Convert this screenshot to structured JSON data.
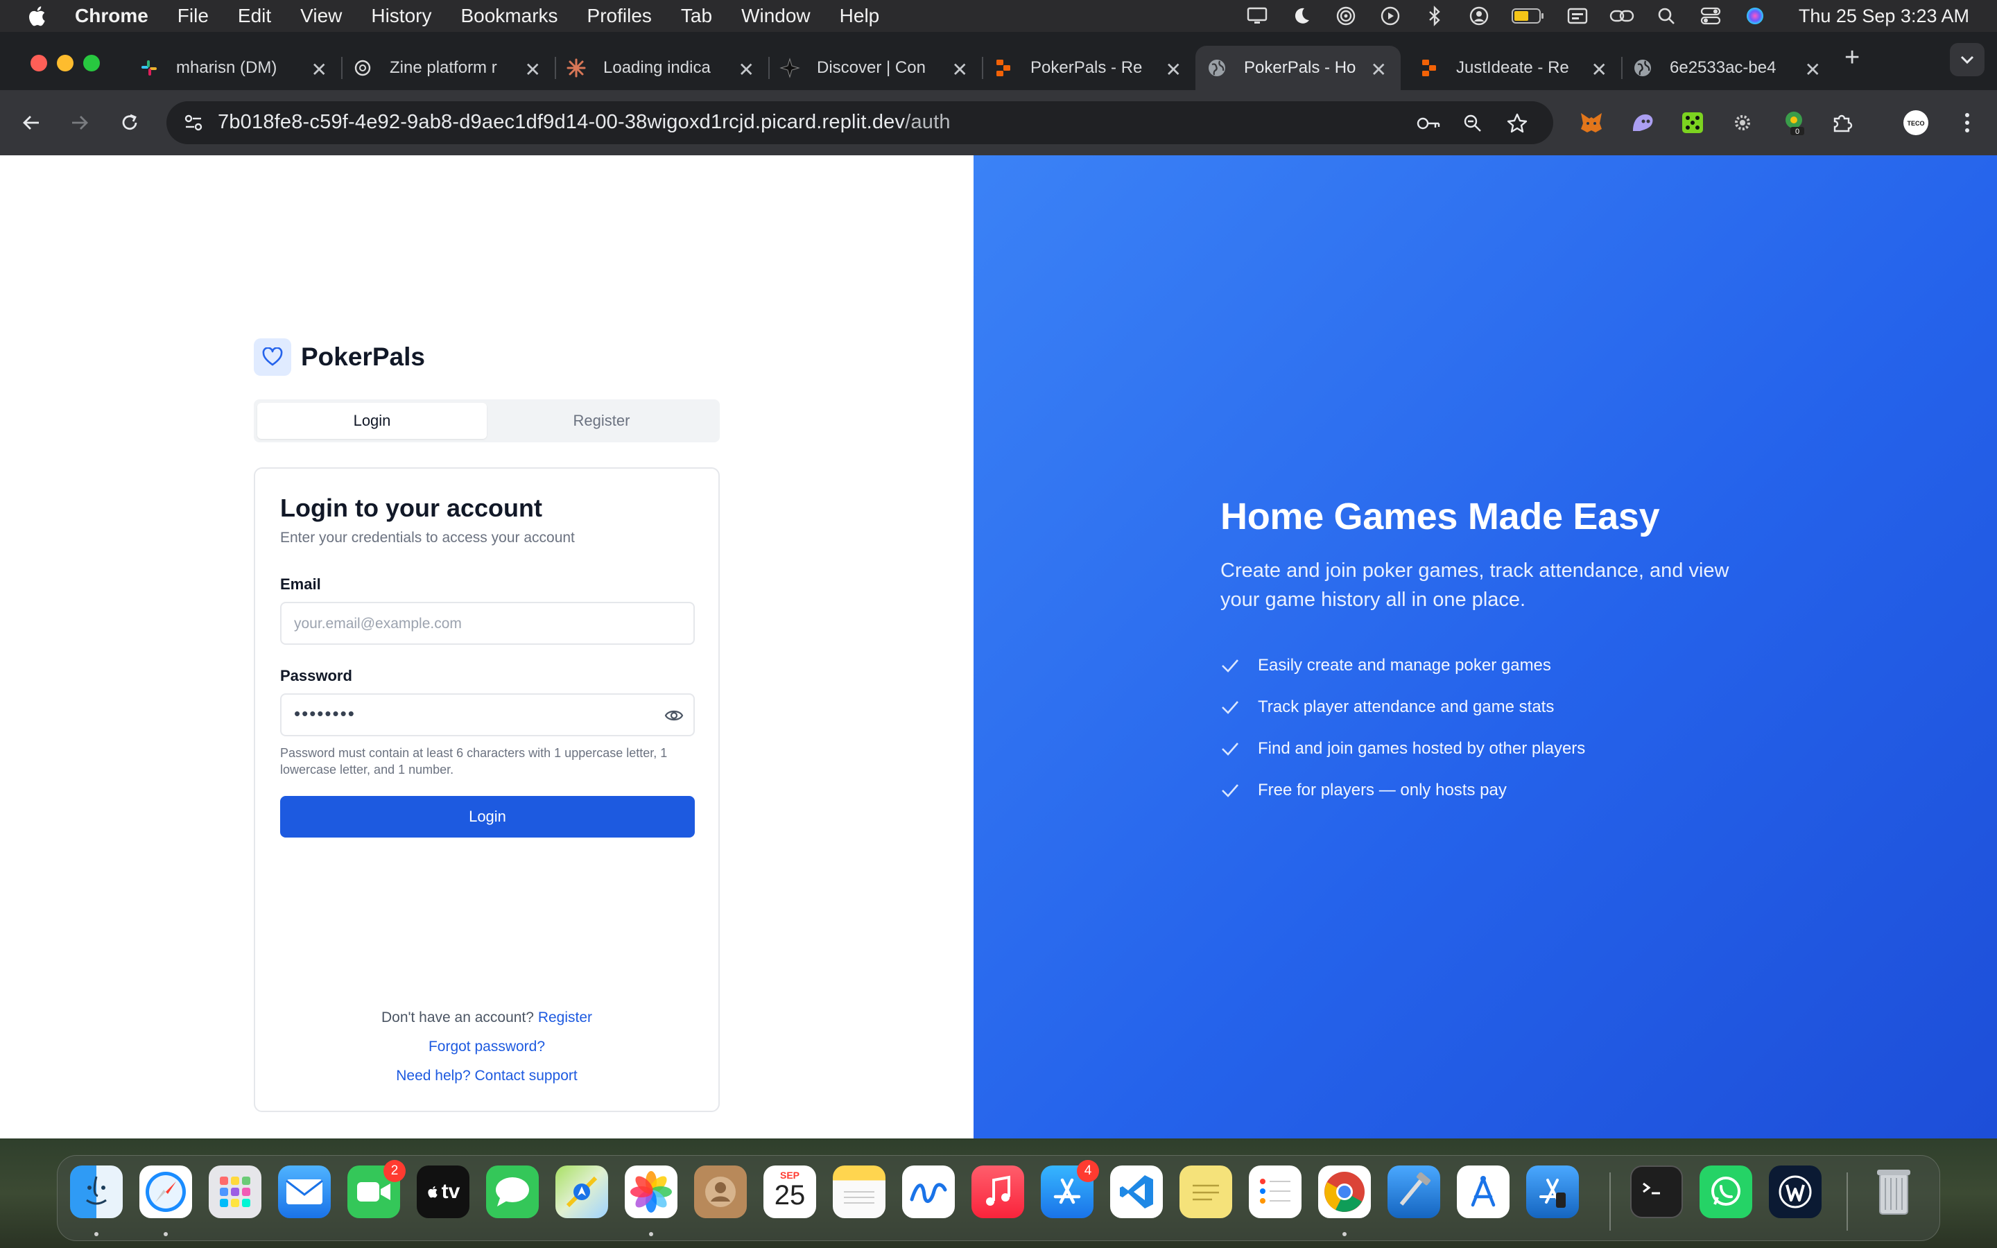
{
  "menubar": {
    "app_name": "Chrome",
    "items": [
      "File",
      "Edit",
      "View",
      "History",
      "Bookmarks",
      "Profiles",
      "Tab",
      "Window",
      "Help"
    ],
    "clock": "Thu 25 Sep  3:23 AM",
    "status_icons": [
      "display-icon",
      "moon-icon",
      "airdrop-icon",
      "play-icon",
      "bluetooth-icon",
      "user-icon",
      "battery-icon",
      "keyboard-icon",
      "link-icon",
      "search-icon",
      "control-center-icon",
      "siri-icon"
    ]
  },
  "browser": {
    "tabs": [
      {
        "title": "mharisn (DM)",
        "icon": "slack-icon"
      },
      {
        "title": "Zine platform r",
        "icon": "openai-icon"
      },
      {
        "title": "Loading indica",
        "icon": "claude-icon"
      },
      {
        "title": "Discover | Con",
        "icon": "star-icon"
      },
      {
        "title": "PokerPals - Re",
        "icon": "replit-icon"
      },
      {
        "title": "PokerPals - Ho",
        "icon": "globe-icon"
      },
      {
        "title": "JustIdeate - Re",
        "icon": "replit-icon"
      },
      {
        "title": "6e2533ac-be4",
        "icon": "globe-icon"
      }
    ],
    "active_tab_index": 5,
    "url_host": "7b018fe8-c59f-4e92-9ab8-d9aec1df9d14-00-38wigoxd1rcjd.picard.replit.dev",
    "url_path": "/auth",
    "profile_label": "TECO"
  },
  "auth": {
    "brand": "PokerPals",
    "tab_login": "Login",
    "tab_register": "Register",
    "card_title": "Login to your account",
    "card_subtitle": "Enter your credentials to access your account",
    "email_label": "Email",
    "email_placeholder": "your.email@example.com",
    "password_label": "Password",
    "password_value": "••••••••",
    "password_hint": "Password must contain at least 6 characters with 1 uppercase letter, 1 lowercase letter, and 1 number.",
    "login_button": "Login",
    "no_account_text": "Don't have an account?",
    "register_link": "Register",
    "forgot_link": "Forgot password?",
    "help_link": "Need help? Contact support"
  },
  "hero": {
    "title": "Home Games Made Easy",
    "description": "Create and join poker games, track attendance, and view your game history all in one place.",
    "features": [
      "Easily create and manage poker games",
      "Track player attendance and game stats",
      "Find and join games hosted by other players",
      "Free for players — only hosts pay"
    ]
  },
  "dock": {
    "apps": [
      "Finder",
      "Safari",
      "Launchpad",
      "Mail",
      "FaceTime",
      "TV",
      "Messages",
      "Maps",
      "Photos",
      "Contacts",
      "Calendar",
      "Notes",
      "Freeform",
      "Music",
      "App Store",
      "VS Code",
      "Stickies",
      "Reminders",
      "Chrome",
      "Xcode",
      "Instruments",
      "Simulator",
      "Terminal",
      "WhatsApp",
      "Windscribe",
      "Trash"
    ],
    "facetime_badge": "2",
    "appstore_badge": "4",
    "calendar_month": "SEP",
    "calendar_day": "25",
    "tv_label": "tv"
  },
  "colors": {
    "primary": "#1d5ae0",
    "hero_gradient_start": "#3b82f6",
    "hero_gradient_end": "#1d4ed8"
  }
}
